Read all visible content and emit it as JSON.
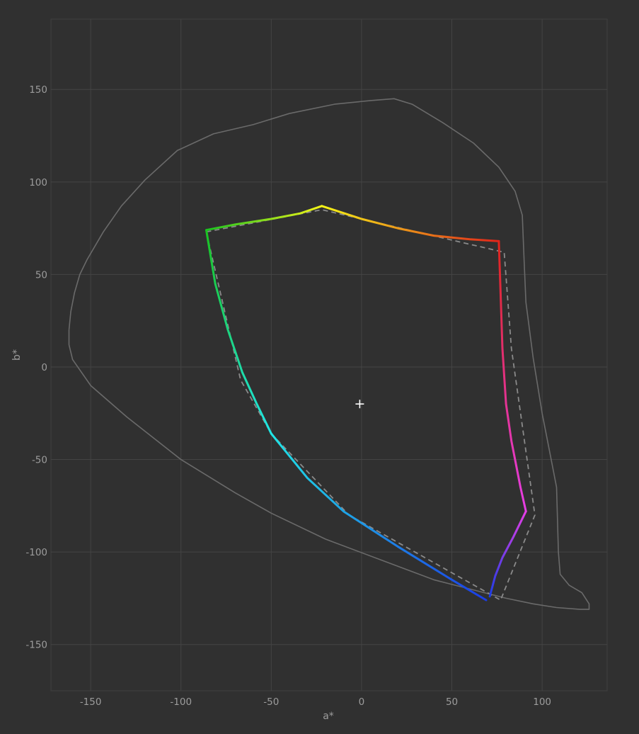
{
  "chart_data": {
    "type": "line",
    "title": "",
    "xlabel": "a*",
    "ylabel": "b*",
    "xlim": [
      -172,
      136
    ],
    "ylim": [
      -175,
      188
    ],
    "x_ticks": [
      -150,
      -100,
      -50,
      0,
      50,
      100
    ],
    "y_ticks": [
      -150,
      -100,
      -50,
      0,
      50,
      100,
      150
    ],
    "x_tick_labels": [
      "-150",
      "-100",
      "-50",
      "0",
      "50",
      "100"
    ],
    "y_tick_labels": [
      "-150",
      "-100",
      "-50",
      "0",
      "50",
      "100",
      "150"
    ],
    "grid": true,
    "colors": {
      "background": "#303030",
      "grid": "#444444",
      "text": "#9c9c9c",
      "spectral_locus": "#6a6a6a",
      "reference_gamut": "#8a8a8a",
      "white_point": "#ffffff"
    },
    "series": [
      {
        "kind": "spectral-locus",
        "style": "solid",
        "points": [
          [
            -162,
            20
          ],
          [
            -161,
            30
          ],
          [
            -159,
            40
          ],
          [
            -156,
            50
          ],
          [
            -152,
            58
          ],
          [
            -143,
            73
          ],
          [
            -133,
            87
          ],
          [
            -120,
            101
          ],
          [
            -102,
            117
          ],
          [
            -82,
            126
          ],
          [
            -60,
            131
          ],
          [
            -40,
            137
          ],
          [
            -15,
            142
          ],
          [
            5,
            144
          ],
          [
            18,
            145
          ],
          [
            28,
            142
          ],
          [
            45,
            132
          ],
          [
            62,
            121
          ],
          [
            76,
            108
          ],
          [
            85,
            95
          ],
          [
            89,
            82
          ],
          [
            90,
            58
          ],
          [
            91,
            35
          ],
          [
            95,
            5
          ],
          [
            100,
            -25
          ],
          [
            105,
            -50
          ],
          [
            108,
            -65
          ],
          [
            109,
            -100
          ],
          [
            110,
            -112
          ],
          [
            115,
            -118
          ],
          [
            122,
            -122
          ],
          [
            126,
            -128
          ],
          [
            126,
            -131
          ],
          [
            121,
            -131
          ],
          [
            108,
            -130
          ],
          [
            95,
            -128
          ],
          [
            80,
            -125
          ],
          [
            60,
            -120
          ],
          [
            40,
            -115
          ],
          [
            10,
            -104
          ],
          [
            -20,
            -93
          ],
          [
            -50,
            -79
          ],
          [
            -70,
            -68
          ],
          [
            -100,
            -50
          ],
          [
            -130,
            -27
          ],
          [
            -150,
            -10
          ],
          [
            -160,
            4
          ],
          [
            -162,
            12
          ],
          [
            -162,
            20
          ]
        ]
      },
      {
        "kind": "reference-gamut",
        "style": "dashed",
        "points": [
          [
            -86,
            73
          ],
          [
            -22,
            85
          ],
          [
            79,
            62
          ],
          [
            83,
            10
          ],
          [
            96,
            -80
          ],
          [
            77,
            -126
          ],
          [
            -7,
            -80
          ],
          [
            -50,
            -36
          ],
          [
            -67,
            -7
          ],
          [
            -86,
            73
          ]
        ]
      },
      {
        "kind": "display-gamut",
        "style": "solid-gradient",
        "segments": [
          {
            "from": "green",
            "to": "yellow",
            "points": [
              [
                -86,
                74
              ],
              [
                -70,
                77
              ],
              [
                -50,
                80
              ],
              [
                -34,
                83
              ],
              [
                -22,
                87
              ]
            ],
            "colors": [
              "#19c41f",
              "#f5f518"
            ]
          },
          {
            "from": "yellow",
            "to": "red",
            "points": [
              [
                -22,
                87
              ],
              [
                0,
                80
              ],
              [
                20,
                75
              ],
              [
                40,
                71
              ],
              [
                60,
                69
              ],
              [
                76,
                68
              ]
            ],
            "colors": [
              "#f5f518",
              "#e0241a"
            ]
          },
          {
            "from": "red",
            "to": "magenta",
            "points": [
              [
                76,
                68
              ],
              [
                77,
                40
              ],
              [
                78,
                10
              ],
              [
                80,
                -20
              ],
              [
                83,
                -40
              ],
              [
                88,
                -65
              ],
              [
                91,
                -78
              ]
            ],
            "colors": [
              "#e0241a",
              "#e63ee6"
            ]
          },
          {
            "from": "magenta",
            "to": "blue",
            "points": [
              [
                91,
                -78
              ],
              [
                84,
                -92
              ],
              [
                78,
                -103
              ],
              [
                74,
                -113
              ],
              [
                71,
                -124
              ]
            ],
            "colors": [
              "#e63ee6",
              "#1b3ce6"
            ]
          },
          {
            "from": "blue",
            "to": "cyan",
            "points": [
              [
                69,
                -126
              ],
              [
                50,
                -115
              ],
              [
                20,
                -97
              ],
              [
                -10,
                -78
              ],
              [
                -30,
                -60
              ],
              [
                -50,
                -36
              ]
            ],
            "colors": [
              "#1b3ce6",
              "#20e6e6"
            ]
          },
          {
            "from": "cyan",
            "to": "green",
            "points": [
              [
                -50,
                -36
              ],
              [
                -58,
                -20
              ],
              [
                -66,
                -3
              ],
              [
                -74,
                20
              ],
              [
                -81,
                45
              ],
              [
                -86,
                74
              ]
            ],
            "colors": [
              "#20e6e6",
              "#19c41f"
            ]
          }
        ]
      }
    ],
    "white_point": {
      "a": -1,
      "b": -20
    }
  }
}
